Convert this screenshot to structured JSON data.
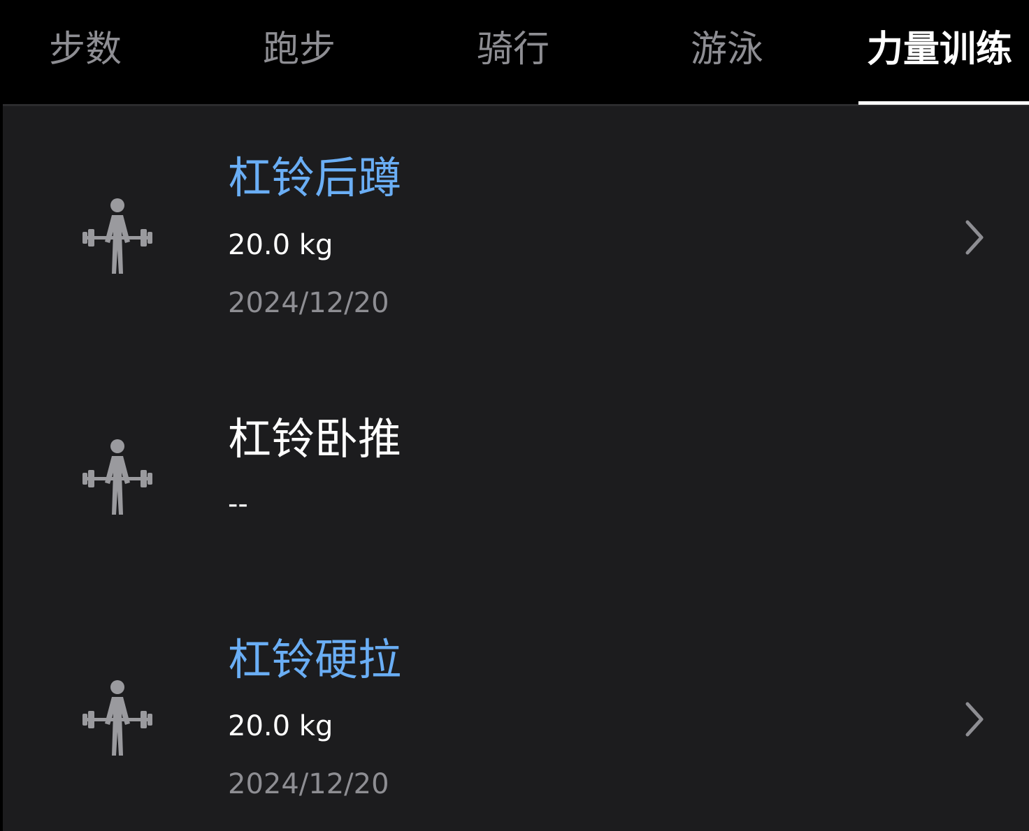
{
  "tabs": [
    {
      "label": "步数"
    },
    {
      "label": "跑步"
    },
    {
      "label": "骑行"
    },
    {
      "label": "游泳"
    },
    {
      "label": "力量训练",
      "active": true
    }
  ],
  "exercises": [
    {
      "name": "杠铃后蹲",
      "value": "20.0 kg",
      "date": "2024/12/20",
      "icon": "weightlifting-icon",
      "has_detail": true
    },
    {
      "name": "杠铃卧推",
      "value": "--",
      "date": "",
      "icon": "weightlifting-icon",
      "has_detail": false
    },
    {
      "name": "杠铃硬拉",
      "value": "20.0 kg",
      "date": "2024/12/20",
      "icon": "weightlifting-icon",
      "has_detail": true
    }
  ],
  "colors": {
    "background": "#1c1c1e",
    "tabbar": "#000000",
    "accent": "#6aaef5",
    "inactive_tab": "#8e8e93",
    "icon": "#9a9a9e"
  }
}
